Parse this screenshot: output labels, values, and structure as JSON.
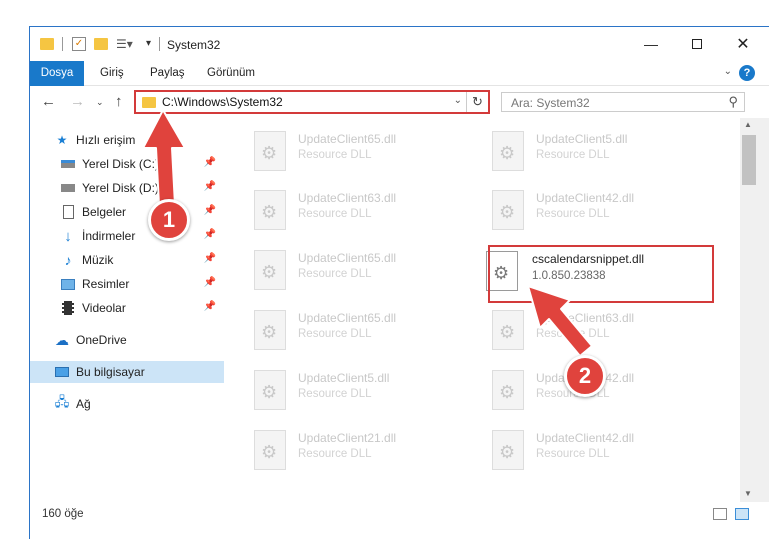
{
  "window": {
    "title": "System32",
    "minimize_icon": "minimize-icon",
    "maximize_icon": "maximize-icon",
    "close_icon": "close-icon"
  },
  "ribbon": {
    "tabs": [
      "Dosya",
      "Giriş",
      "Paylaş",
      "Görünüm"
    ],
    "help": "?"
  },
  "address": {
    "path": "C:\\Windows\\System32",
    "search_placeholder": "Ara: System32"
  },
  "sidebar": {
    "items": [
      {
        "label": "Hızlı erişim",
        "icon": "star-icon"
      },
      {
        "label": "Yerel Disk (C:)",
        "icon": "drive-icon",
        "pinned": true
      },
      {
        "label": "Yerel Disk (D:)",
        "icon": "drive-icon",
        "pinned": true
      },
      {
        "label": "Belgeler",
        "icon": "document-icon",
        "pinned": true
      },
      {
        "label": "İndirmeler",
        "icon": "download-icon",
        "pinned": true
      },
      {
        "label": "Müzik",
        "icon": "music-icon",
        "pinned": true
      },
      {
        "label": "Resimler",
        "icon": "picture-icon",
        "pinned": true
      },
      {
        "label": "Videolar",
        "icon": "video-icon",
        "pinned": true
      },
      {
        "label": "OneDrive",
        "icon": "cloud-icon"
      },
      {
        "label": "Bu bilgisayar",
        "icon": "computer-icon",
        "selected": true
      },
      {
        "label": "Ağ",
        "icon": "network-icon"
      }
    ]
  },
  "files": [
    {
      "name": "UpdateClient65.dll",
      "desc": "Resource DLL"
    },
    {
      "name": "UpdateClient5.dll",
      "desc": "Resource DLL"
    },
    {
      "name": "UpdateClient63.dll",
      "desc": "Resource DLL"
    },
    {
      "name": "UpdateClient42.dll",
      "desc": "Resource DLL"
    },
    {
      "name": "UpdateClient65.dll",
      "desc": "Resource DLL"
    },
    {
      "name": "cscalendarsnippet.dll",
      "desc": "1.0.850.23838",
      "highlighted": true
    },
    {
      "name": "UpdateClient65.dll",
      "desc": "Resource DLL"
    },
    {
      "name": "UpdateClient63.dll",
      "desc": "Resource DLL"
    },
    {
      "name": "UpdateClient5.dll",
      "desc": "Resource DLL"
    },
    {
      "name": "UpdateClient42.dll",
      "desc": "Resource DLL"
    },
    {
      "name": "UpdateClient21.dll",
      "desc": "Resource DLL"
    },
    {
      "name": "UpdateClient42.dll",
      "desc": "Resource DLL"
    }
  ],
  "status": {
    "count": "160 öğe"
  },
  "callouts": [
    "1",
    "2"
  ],
  "colors": {
    "accent": "#1979ca",
    "highlight_box": "#d33a3a",
    "callout": "#e0433d",
    "selection": "#cce4f7"
  }
}
